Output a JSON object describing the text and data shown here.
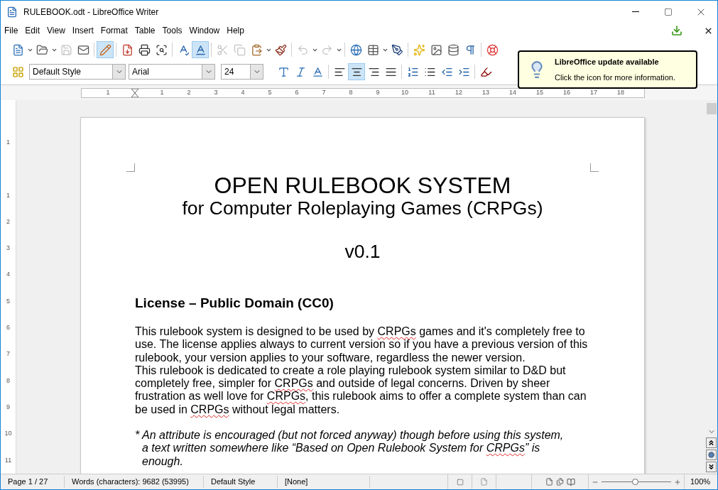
{
  "window": {
    "title": "RULEBOOK.odt - LibreOffice Writer"
  },
  "menu": [
    "File",
    "Edit",
    "View",
    "Insert",
    "Format",
    "Table",
    "Tools",
    "Window",
    "Help"
  ],
  "toolbar_standard": [
    {
      "kind": "new",
      "selected": false,
      "disabled": false,
      "dropdown": true
    },
    {
      "kind": "open",
      "selected": false,
      "disabled": false,
      "dropdown": true
    },
    {
      "kind": "save",
      "selected": false,
      "disabled": true,
      "dropdown": false
    },
    {
      "kind": "mail",
      "selected": false,
      "disabled": false,
      "dropdown": false
    },
    {
      "kind": "sep"
    },
    {
      "kind": "edit",
      "selected": true,
      "disabled": false,
      "dropdown": false
    },
    {
      "kind": "sep"
    },
    {
      "kind": "pdf",
      "selected": false,
      "disabled": false,
      "dropdown": false
    },
    {
      "kind": "print",
      "selected": false,
      "disabled": false,
      "dropdown": false
    },
    {
      "kind": "preview",
      "selected": false,
      "disabled": false,
      "dropdown": false
    },
    {
      "kind": "sep"
    },
    {
      "kind": "spell",
      "selected": false,
      "disabled": false,
      "dropdown": false
    },
    {
      "kind": "autospell",
      "selected": true,
      "disabled": false,
      "dropdown": false
    },
    {
      "kind": "sep"
    },
    {
      "kind": "cut",
      "selected": false,
      "disabled": true,
      "dropdown": false
    },
    {
      "kind": "copy",
      "selected": false,
      "disabled": true,
      "dropdown": false
    },
    {
      "kind": "paste",
      "selected": false,
      "disabled": false,
      "dropdown": true
    },
    {
      "kind": "brush",
      "selected": false,
      "disabled": false,
      "dropdown": false
    },
    {
      "kind": "sep"
    },
    {
      "kind": "undo",
      "selected": false,
      "disabled": true,
      "dropdown": true
    },
    {
      "kind": "redo",
      "selected": false,
      "disabled": true,
      "dropdown": true
    },
    {
      "kind": "sep"
    },
    {
      "kind": "globe",
      "selected": false,
      "disabled": false,
      "dropdown": false
    },
    {
      "kind": "table",
      "selected": false,
      "disabled": false,
      "dropdown": true
    },
    {
      "kind": "draw",
      "selected": false,
      "disabled": false,
      "dropdown": false
    },
    {
      "kind": "sep"
    },
    {
      "kind": "star",
      "selected": false,
      "disabled": false,
      "dropdown": false
    },
    {
      "kind": "image",
      "selected": false,
      "disabled": false,
      "dropdown": false
    },
    {
      "kind": "chart",
      "selected": false,
      "disabled": false,
      "dropdown": false
    },
    {
      "kind": "pilcrow",
      "selected": false,
      "disabled": false,
      "dropdown": false
    },
    {
      "kind": "sep"
    },
    {
      "kind": "help",
      "selected": false,
      "disabled": false,
      "dropdown": false
    }
  ],
  "formatting": {
    "style": "Default Style",
    "font": "Arial",
    "size": "24"
  },
  "toolbar_formatting": [
    {
      "kind": "a-shadow",
      "selected": false
    },
    {
      "kind": "a-italic",
      "selected": false
    },
    {
      "kind": "a-outline",
      "selected": false
    },
    {
      "kind": "sep"
    },
    {
      "kind": "left",
      "selected": false
    },
    {
      "kind": "center",
      "selected": true
    },
    {
      "kind": "right",
      "selected": false
    },
    {
      "kind": "justify",
      "selected": false
    },
    {
      "kind": "sep"
    },
    {
      "kind": "numbered",
      "selected": false
    },
    {
      "kind": "bulleted",
      "selected": false
    },
    {
      "kind": "outdent",
      "selected": false
    },
    {
      "kind": "indent",
      "selected": false
    },
    {
      "kind": "sep"
    },
    {
      "kind": "highlight",
      "selected": false
    }
  ],
  "update_notice": {
    "title": "LibreOffice update available",
    "message": "Click the icon for more information."
  },
  "horizontal_ruler": [
    "1",
    "1",
    "2",
    "3",
    "4",
    "5",
    "6",
    "7",
    "8",
    "9",
    "10",
    "11",
    "12",
    "13",
    "14",
    "15",
    "16",
    "17",
    "18"
  ],
  "vertical_ruler": [
    "1",
    "1",
    "2",
    "3",
    "4",
    "5",
    "6",
    "7",
    "8",
    "9",
    "10",
    "11"
  ],
  "document": {
    "title": "OPEN RULEBOOK SYSTEM",
    "subtitle": "for Computer Roleplaying Games (CRPGs)",
    "version": "v0.1",
    "heading": "License – Public Domain (CC0)",
    "paragraphs": [
      [
        {
          "text": "This rulebook system is designed to be used by ",
          "misspelled": false
        },
        {
          "text": "CRPGs",
          "misspelled": true
        },
        {
          "text": " games and it's completely free to use. The license applies always to current version so if you have a previous version of this rulebook, your version applies to your software, regardless the newer version.",
          "misspelled": false
        }
      ],
      [
        {
          "text": "This rulebook is dedicated to create a role playing rulebook system similar to D&D but completely free, simpler for ",
          "misspelled": false
        },
        {
          "text": "CRPGs",
          "misspelled": true
        },
        {
          "text": " and outside of legal concerns. Driven by sheer frustration as well love for ",
          "misspelled": false
        },
        {
          "text": "CRPGs",
          "misspelled": true
        },
        {
          "text": ", this rulebook aims to offer a complete system than can be used in ",
          "misspelled": false
        },
        {
          "text": "CRPGs",
          "misspelled": true
        },
        {
          "text": " without legal matters.",
          "misspelled": false
        }
      ]
    ],
    "note": [
      {
        "text": "* An attribute is encouraged (but not forced anyway) though before using this system, a text written somewhere like “Based on Open Rulebook System for ",
        "misspelled": false
      },
      {
        "text": "CRPGs",
        "misspelled": true
      },
      {
        "text": "” is enough.",
        "misspelled": false
      }
    ]
  },
  "status_bar": {
    "page": "Page 1 / 27",
    "words": "Words (characters): 9682 (53995)",
    "style": "Default Style",
    "language": "[None]",
    "zoom": "100%",
    "zoom_slider": {
      "level": 0.48
    }
  }
}
